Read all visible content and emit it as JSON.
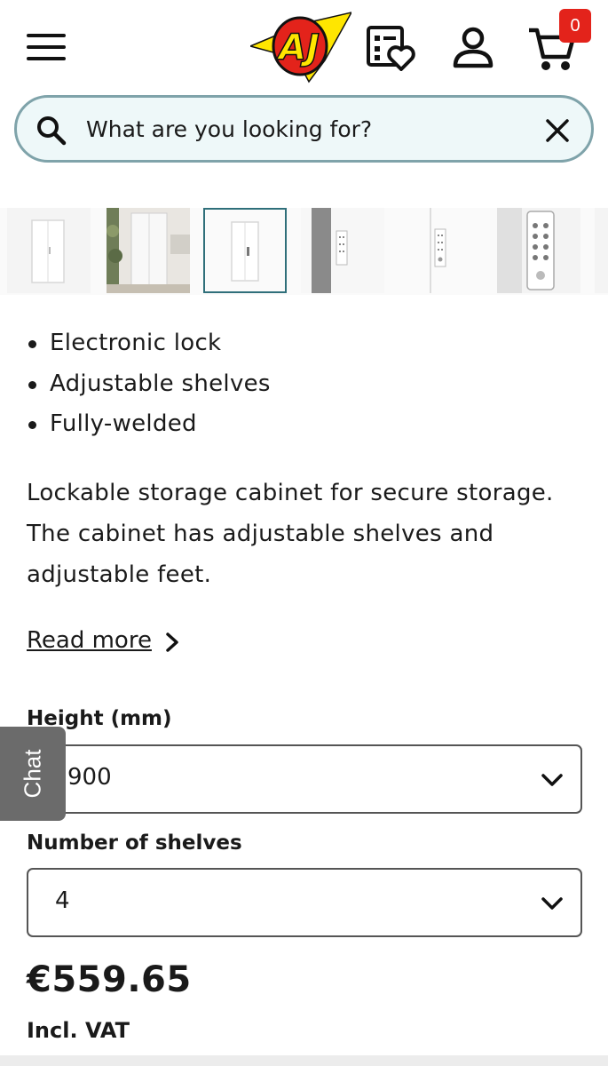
{
  "header": {
    "menu_icon": "hamburger-menu-icon",
    "logo_text": "AJ",
    "wishlist_icon": "wishlist-heart-icon",
    "account_icon": "user-account-icon",
    "cart_icon": "shopping-cart-icon",
    "cart_count": "0"
  },
  "search": {
    "placeholder": "What are you looking for?",
    "search_icon": "magnifier-icon",
    "clear_icon": "close-icon"
  },
  "gallery": {
    "thumbnails": [
      "cabinet-front-closed",
      "cabinet-in-room",
      "cabinet-front-selected",
      "cabinet-lock-side",
      "cabinet-lock-front",
      "keypad-lock-closeup"
    ],
    "selected_index": 2
  },
  "features": [
    "Electronic lock",
    "Adjustable shelves",
    "Fully-welded"
  ],
  "description_lines": [
    "Lockable storage cabinet for secure storage.",
    "The cabinet has adjustable shelves and",
    "adjustable feet."
  ],
  "read_more_label": "Read more",
  "height": {
    "label": "Height (mm)",
    "value": "900"
  },
  "shelves": {
    "label": "Number of shelves",
    "value": "4"
  },
  "chat_label": "Chat",
  "price": "€559.65",
  "vat_label": "Incl. VAT",
  "colors": {
    "accent": "#2f6f7a",
    "search_bg": "#eef8f9",
    "badge": "#e3231b",
    "logo_red": "#e3231b",
    "logo_yellow": "#ffe600"
  }
}
